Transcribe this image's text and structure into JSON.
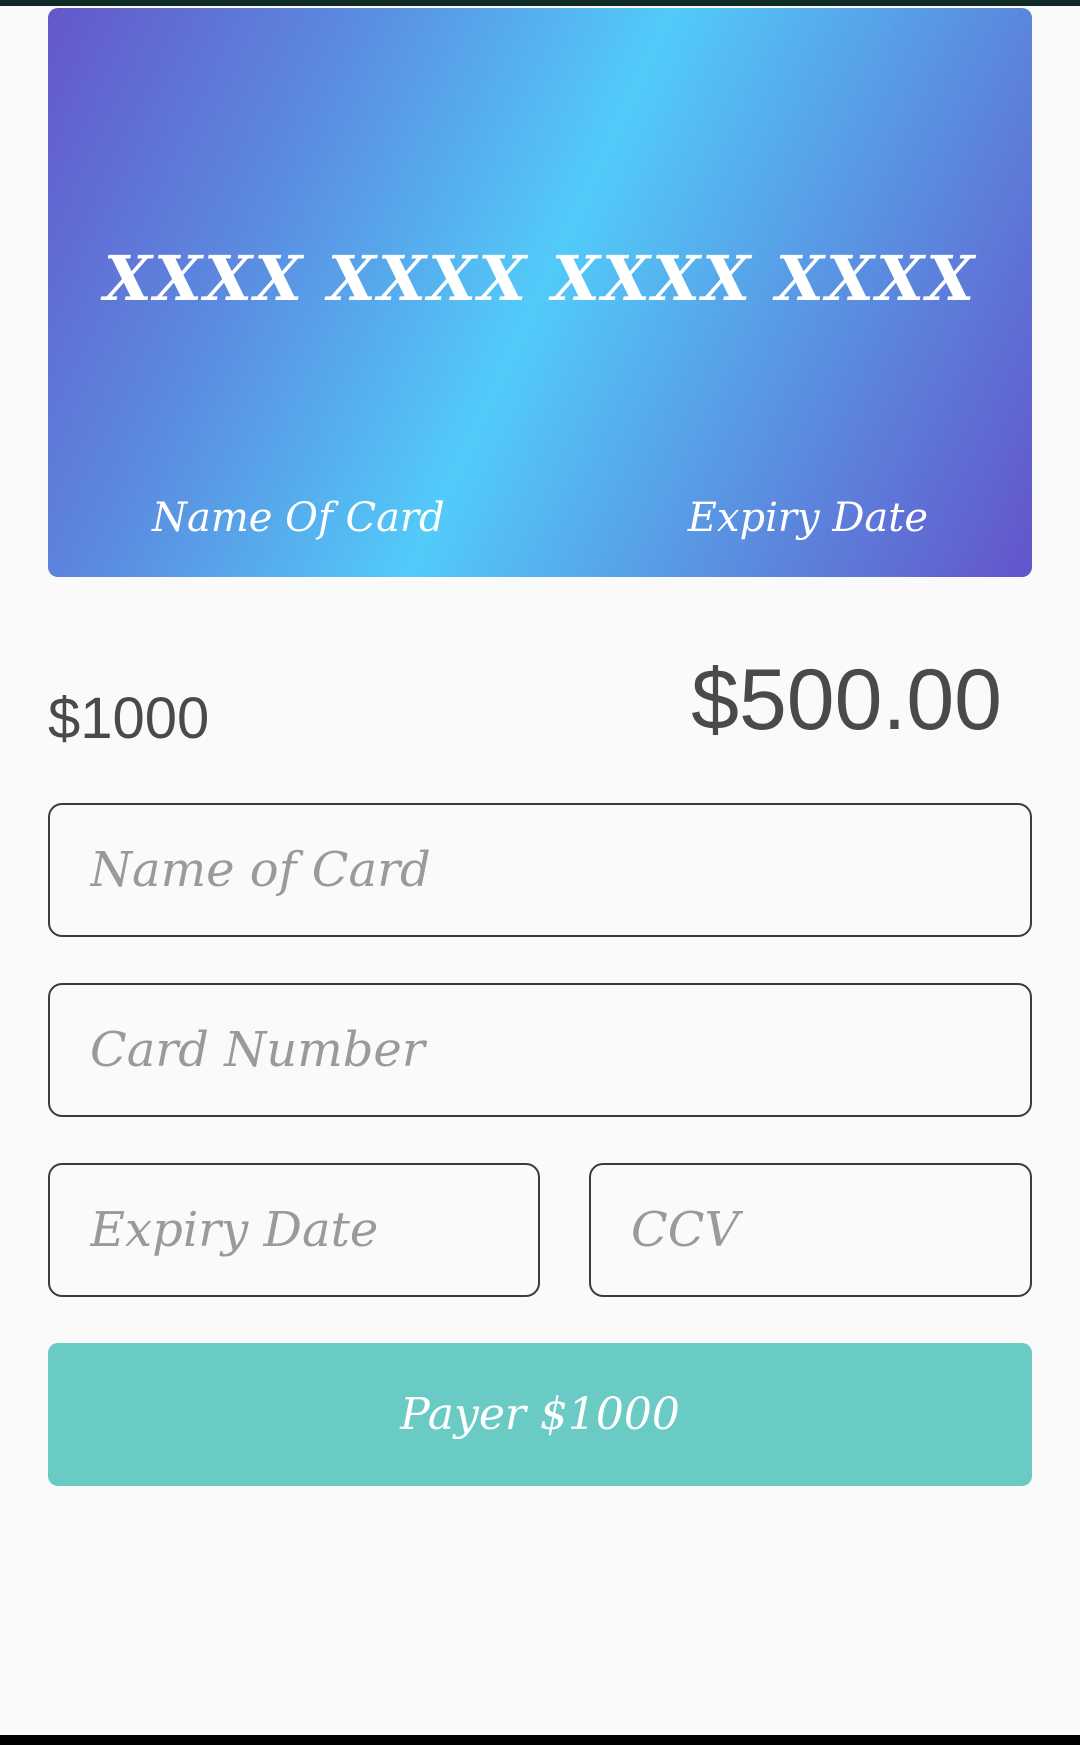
{
  "card": {
    "number": "XXXX XXXX XXXX XXXX",
    "name_label": "Name Of Card",
    "expiry_label": "Expiry Date"
  },
  "amounts": {
    "left": "$1000",
    "right": "$500.00"
  },
  "form": {
    "name_placeholder": "Name of Card",
    "number_placeholder": "Card Number",
    "expiry_placeholder": "Expiry Date",
    "ccv_placeholder": "CCV"
  },
  "pay_button": {
    "label": "Payer $1000"
  },
  "colors": {
    "background": "#fafafa",
    "card_gradient_edge": "#6457cb",
    "card_gradient_center": "#52cbf9",
    "button": "#69cbc4",
    "text_dark": "#4a4a4a",
    "placeholder": "#9a9a9a",
    "field_border": "#3c3c3c"
  }
}
